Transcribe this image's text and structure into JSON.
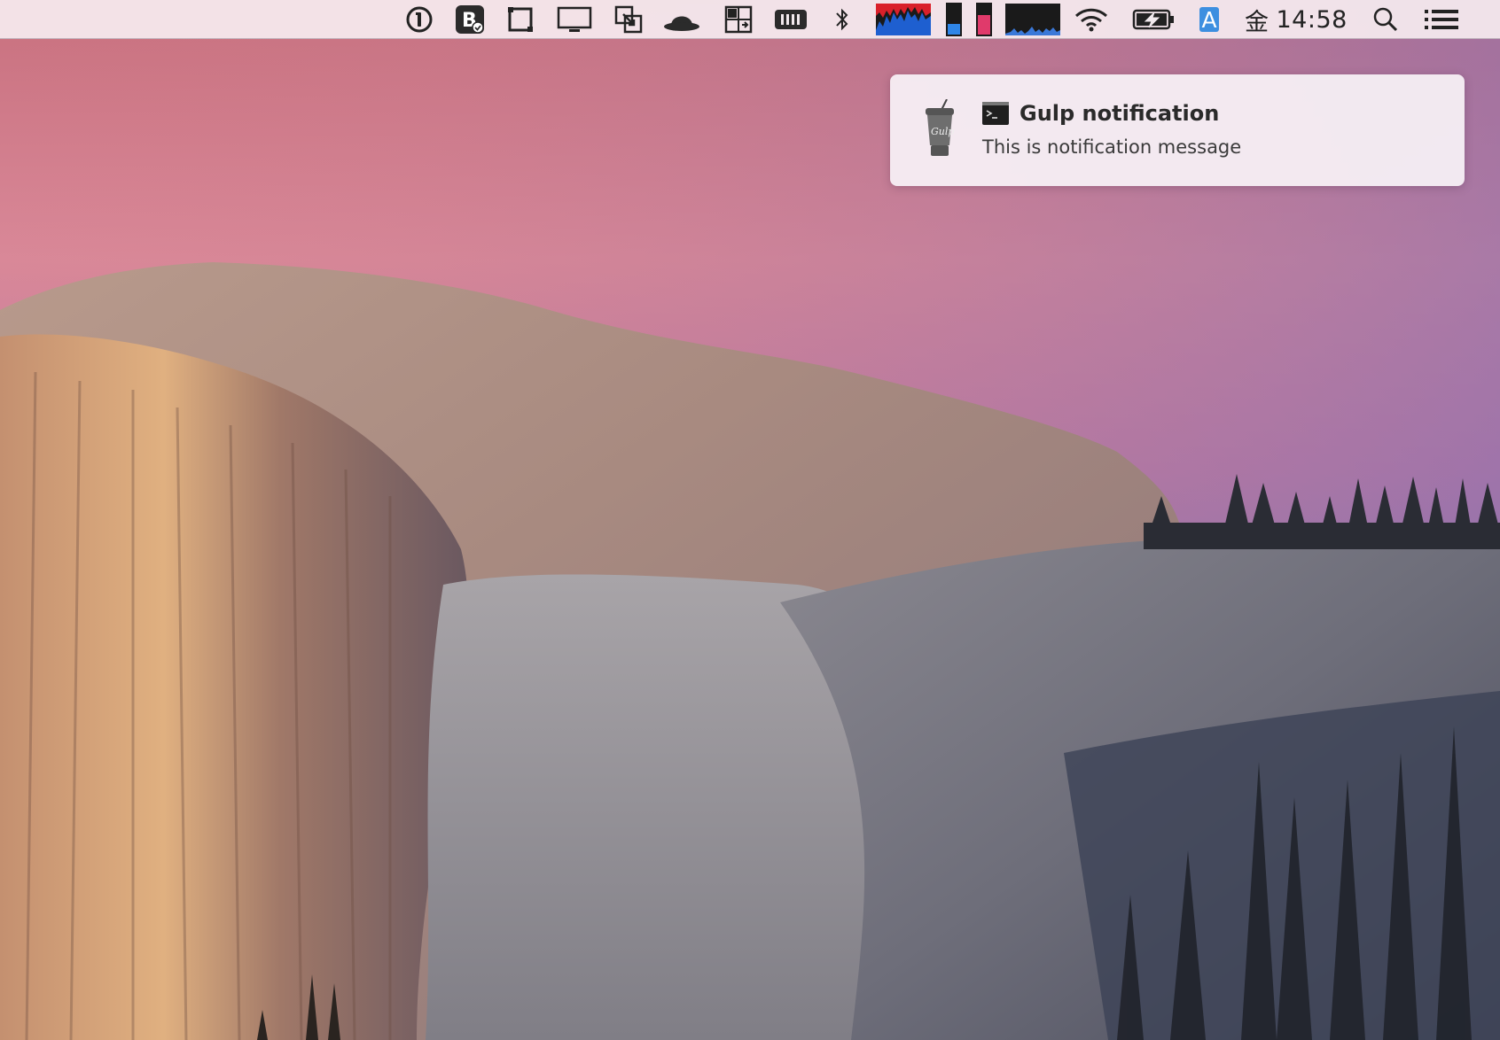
{
  "menubar": {
    "icons": [
      {
        "name": "1password-icon"
      },
      {
        "name": "bartender-icon"
      },
      {
        "name": "window-frame-icon"
      },
      {
        "name": "display-icon"
      },
      {
        "name": "screen-resize-icon"
      },
      {
        "name": "bowler-hat-icon"
      },
      {
        "name": "window-tiling-icon"
      },
      {
        "name": "memory-icon"
      },
      {
        "name": "bluetooth-icon"
      },
      {
        "name": "cpu-graph-icon"
      },
      {
        "name": "disk-gauge-icon"
      },
      {
        "name": "memory-gauge-icon"
      },
      {
        "name": "network-graph-icon"
      },
      {
        "name": "wifi-icon"
      },
      {
        "name": "battery-charging-icon"
      },
      {
        "name": "input-source-icon"
      },
      {
        "name": "spotlight-search-icon"
      },
      {
        "name": "notification-center-icon"
      }
    ],
    "input_source_label": "A",
    "clock": {
      "day": "金",
      "time": "14:58"
    },
    "colors": {
      "cpu_red": "#d9202a",
      "cpu_blue": "#1e5fd0",
      "disk_blue": "#2f86e8",
      "memory_pink": "#e03a6b",
      "input_blue": "#3d8fe0"
    }
  },
  "notification": {
    "app_icon": "gulp-cup-icon",
    "source_icon": "terminal-icon",
    "title": "Gulp notification",
    "message": "This is notification message"
  }
}
